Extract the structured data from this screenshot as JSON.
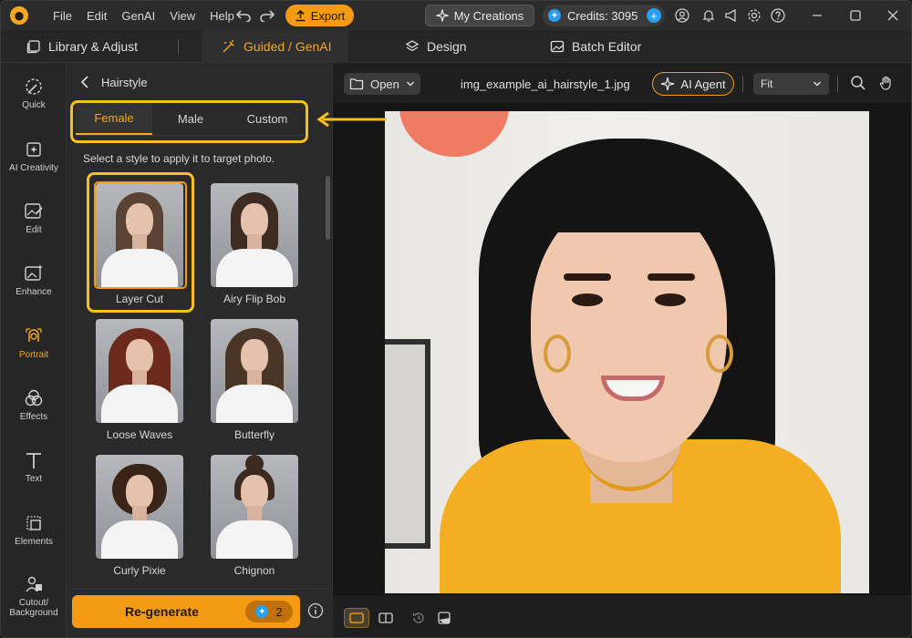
{
  "menu": [
    "File",
    "Edit",
    "GenAI",
    "View",
    "Help"
  ],
  "toolbar": {
    "export_label": "Export",
    "my_creations_label": "My Creations",
    "credits_label": "Credits: 3095"
  },
  "modes": [
    {
      "label": "Library & Adjust"
    },
    {
      "label": "Guided / GenAI"
    },
    {
      "label": "Design"
    },
    {
      "label": "Batch Editor"
    }
  ],
  "rail": [
    {
      "label": "Quick"
    },
    {
      "label": "AI Creativity"
    },
    {
      "label": "Edit"
    },
    {
      "label": "Enhance"
    },
    {
      "label": "Portrait"
    },
    {
      "label": "Effects"
    },
    {
      "label": "Text"
    },
    {
      "label": "Elements"
    },
    {
      "label_line1": "Cutout/",
      "label_line2": "Background"
    }
  ],
  "panel": {
    "title": "Hairstyle",
    "tabs": [
      "Female",
      "Male",
      "Custom"
    ],
    "hint": "Select a style to apply it to target photo.",
    "styles": [
      "Layer Cut",
      "Airy Flip Bob",
      "Loose Waves",
      "Butterfly",
      "Curly Pixie",
      "Chignon"
    ],
    "regenerate_label": "Re-generate",
    "regenerate_cost": "2"
  },
  "canvas": {
    "open_label": "Open",
    "filename": "img_example_ai_hairstyle_1.jpg",
    "agent_label": "AI Agent",
    "zoom_value": "Fit"
  },
  "colors": {
    "accent": "#f59a13",
    "highlight": "#f5c11a",
    "credit_blue": "#2aa0f0"
  }
}
